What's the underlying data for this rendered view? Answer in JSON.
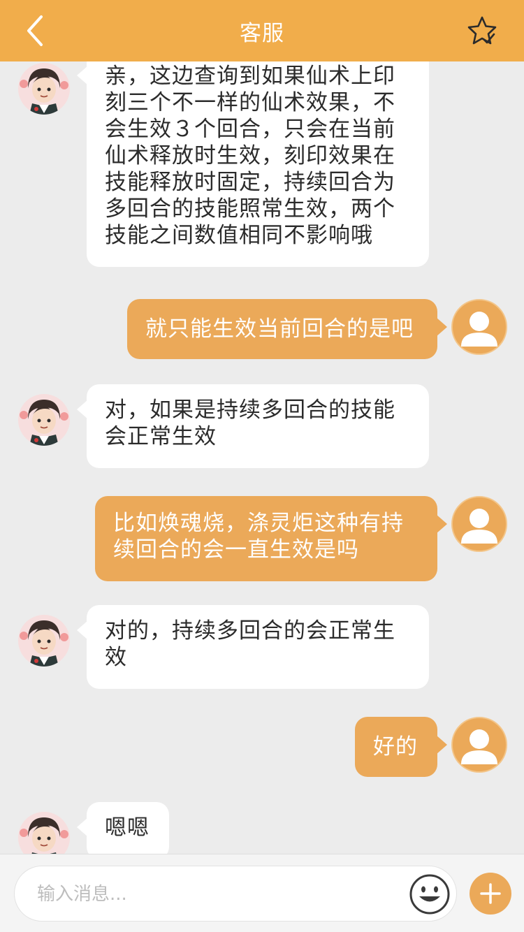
{
  "header": {
    "title": "客服",
    "back_icon": "chevron-left-icon",
    "favorite_icon": "star-check-icon"
  },
  "colors": {
    "header_bg": "#f1ad4b",
    "user_bubble": "#eba959",
    "agent_bubble": "#ffffff",
    "page_bg": "#ececec"
  },
  "messages": [
    {
      "from": "agent",
      "lines": [
        "亲，这边查询到如果仙术上印",
        "刻三个不一样的仙术效果，不",
        "会生效３个回合，只会在当前",
        "仙术释放时生效，刻印效果在",
        "技能释放时固定，持续回合为",
        "多回合的技能照常生效，两个",
        "技能之间数值相同不影响哦"
      ]
    },
    {
      "from": "user",
      "lines": [
        "就只能生效当前回合的是吧"
      ]
    },
    {
      "from": "agent",
      "lines": [
        "对，如果是持续多回合的技能",
        "会正常生效"
      ]
    },
    {
      "from": "user",
      "lines": [
        "比如焕魂烧，涤灵炬这种有持",
        "续回合的会一直生效是吗"
      ]
    },
    {
      "from": "agent",
      "lines": [
        "对的，持续多回合的会正常生",
        "效"
      ]
    },
    {
      "from": "user",
      "lines": [
        "好的"
      ]
    },
    {
      "from": "agent",
      "lines": [
        "嗯嗯"
      ]
    }
  ],
  "input": {
    "placeholder": "输入消息...",
    "emoji_icon": "emoji-smile-icon",
    "add_icon": "plus-icon"
  }
}
